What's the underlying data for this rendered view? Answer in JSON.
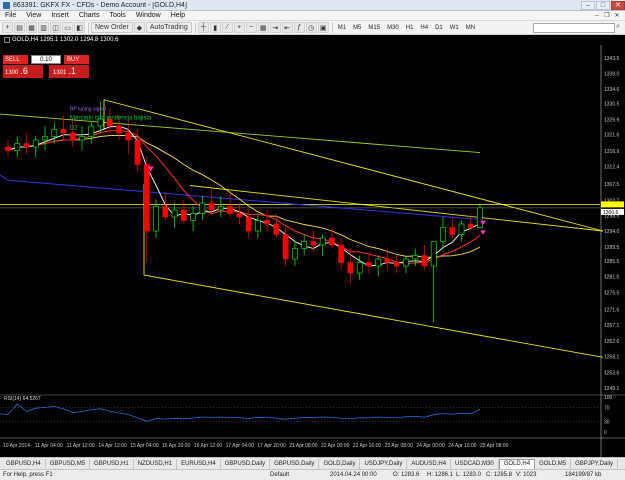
{
  "window": {
    "title": "863391: GKFX FX - CFDs - Demo Account - [GOLD,H4]",
    "min": "–",
    "max": "□",
    "close": "✕"
  },
  "menu": {
    "items": [
      "File",
      "View",
      "Insert",
      "Charts",
      "Tools",
      "Window",
      "Help"
    ]
  },
  "toolbar": {
    "new_order": "New Order",
    "autotrading": "AutoTrading",
    "timeframes": [
      "M1",
      "M5",
      "M15",
      "M30",
      "H1",
      "H4",
      "D1",
      "W1",
      "MN"
    ]
  },
  "chart_header": {
    "text": "GOLD,H4 1295.1 1302.0 1294.8 1300.6"
  },
  "trade_panel": {
    "sell_label": "SELL",
    "buy_label": "BUY",
    "volume": "0.10",
    "sell_price_prefix": "1300",
    "sell_price_big": ".6",
    "buy_price_prefix": "1301",
    "buy_price_big": ".1"
  },
  "chart_data": {
    "type": "candlestick",
    "symbol": "GOLD",
    "timeframe": "H4",
    "ohlc": {
      "open": 1295.1,
      "high": 1302.0,
      "low": 1294.8,
      "close": 1300.6
    },
    "price_axis": [
      "1343.5",
      "1339.0",
      "1334.6",
      "1330.5",
      "1325.9",
      "1321.6",
      "1316.9",
      "1312.4",
      "1307.5",
      "1302.7",
      "1300.6",
      "1298.5",
      "1294.0",
      "1289.5",
      "1285.5",
      "1281.0",
      "1276.5",
      "1271.6",
      "1267.1",
      "1262.6",
      "1258.1",
      "1253.6",
      "1249.1"
    ],
    "ylim": [
      1248,
      1346
    ],
    "current_price": 1300.6,
    "current_price_label": "1300.6",
    "time_axis": [
      "10 Apr 2014",
      "11 Apr 04:00",
      "11 Apr 12:00",
      "14 Apr 12:00",
      "15 Apr 04:00",
      "15 Apr 20:00",
      "16 Apr 12:00",
      "17 Apr 04:00",
      "17 Apr 20:00",
      "21 Apr 08:00",
      "22 Apr 00:00",
      "22 Apr 16:00",
      "23 Apr 08:00",
      "24 Apr 00:00",
      "24 Apr 16:00",
      "25 Apr 08:00"
    ],
    "candles": [
      [
        1318,
        1320,
        1315,
        1317
      ],
      [
        1317,
        1321,
        1315,
        1319
      ],
      [
        1319,
        1322,
        1316,
        1318
      ],
      [
        1318,
        1321,
        1315,
        1320
      ],
      [
        1320,
        1324,
        1317,
        1321
      ],
      [
        1321,
        1325,
        1319,
        1323
      ],
      [
        1323,
        1327,
        1320,
        1322
      ],
      [
        1322,
        1326,
        1318,
        1320
      ],
      [
        1320,
        1324,
        1317,
        1321
      ],
      [
        1321,
        1325,
        1319,
        1324
      ],
      [
        1324,
        1331,
        1322,
        1326
      ],
      [
        1326,
        1329,
        1322,
        1324
      ],
      [
        1324,
        1327,
        1320,
        1322
      ],
      [
        1322,
        1326,
        1316,
        1320
      ],
      [
        1320,
        1323,
        1311,
        1313
      ],
      [
        1313,
        1315,
        1285,
        1294
      ],
      [
        1294,
        1303,
        1292,
        1301
      ],
      [
        1301,
        1305,
        1297,
        1298
      ],
      [
        1298,
        1302,
        1295,
        1300
      ],
      [
        1300,
        1303,
        1296,
        1297
      ],
      [
        1297,
        1301,
        1294,
        1299
      ],
      [
        1299,
        1304,
        1297,
        1302
      ],
      [
        1302,
        1306,
        1299,
        1300
      ],
      [
        1300,
        1304,
        1298,
        1301
      ],
      [
        1301,
        1305,
        1298,
        1299
      ],
      [
        1299,
        1302,
        1296,
        1298
      ],
      [
        1298,
        1300,
        1292,
        1294
      ],
      [
        1294,
        1299,
        1292,
        1297
      ],
      [
        1297,
        1300,
        1294,
        1296
      ],
      [
        1296,
        1299,
        1292,
        1293
      ],
      [
        1293,
        1295,
        1284,
        1286
      ],
      [
        1286,
        1291,
        1284,
        1289
      ],
      [
        1289,
        1293,
        1287,
        1291
      ],
      [
        1291,
        1294,
        1288,
        1290
      ],
      [
        1290,
        1293,
        1287,
        1292
      ],
      [
        1292,
        1295,
        1289,
        1290
      ],
      [
        1290,
        1292,
        1283,
        1285
      ],
      [
        1285,
        1289,
        1279,
        1282
      ],
      [
        1282,
        1287,
        1280,
        1285
      ],
      [
        1285,
        1288,
        1282,
        1284
      ],
      [
        1284,
        1287,
        1281,
        1286
      ],
      [
        1286,
        1289,
        1283,
        1285
      ],
      [
        1285,
        1287,
        1282,
        1284
      ],
      [
        1284,
        1287,
        1282,
        1286
      ],
      [
        1286,
        1289,
        1284,
        1287
      ],
      [
        1287,
        1290,
        1283,
        1284
      ],
      [
        1284,
        1286,
        1268,
        1291
      ],
      [
        1291,
        1298,
        1289,
        1295
      ],
      [
        1295,
        1298,
        1292,
        1293
      ],
      [
        1293,
        1297,
        1291,
        1296
      ],
      [
        1296,
        1299,
        1294,
        1295
      ],
      [
        1295,
        1302,
        1294.8,
        1300.6
      ]
    ],
    "indicator": {
      "name": "RSI(14)",
      "value": 64.5267,
      "label": "RSI(14) 64.5267",
      "levels": [
        "100",
        "70",
        "30",
        "0"
      ]
    }
  },
  "annotations": {
    "line1": "BP tuning signal",
    "line2": "Mercado con tendencia bajista",
    "line3": "D2"
  },
  "tabs": [
    "GBPUSD,H4",
    "GBPUSD,M5",
    "GBPUSD,H1",
    "NZDUSD,H1",
    "EURUSD,H4",
    "GBPUSD,Daily",
    "GBPUSD,Daily",
    "GOLD,Daily",
    "USDJPY,Daily",
    "AUDUSD,H4",
    "USDCAD,M30",
    "GOLD,H4",
    "GOLD,M5",
    "GBPJPY,Daily"
  ],
  "active_tab": "GOLD,H4",
  "status": {
    "help": "For Help, press F1",
    "profile": "Default",
    "datetime": "2014.04.24 00:00",
    "open": "O: 1283.6",
    "high": "H: 1286.1",
    "low": "L: 1283.0",
    "close": "C: 1285.8",
    "volume": "V: 1023",
    "traffic": "184199/87 kb"
  },
  "colors": {
    "up_candle": "#00ff00",
    "down_candle": "#ff0000",
    "ma_white": "#ffffff",
    "ma_red": "#ff3030",
    "ma_yellow": "#ffdf40",
    "ma_blue": "#2a3ae8",
    "trend_yellow": "#f2e600",
    "trend_green": "#9bd31f"
  }
}
